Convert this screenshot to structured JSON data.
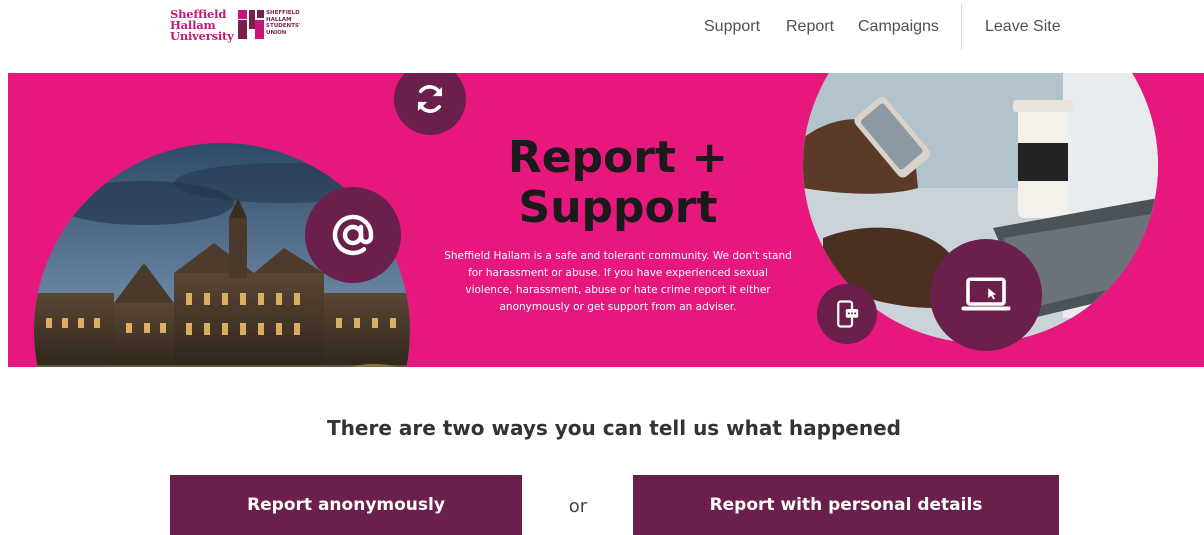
{
  "header": {
    "logo_university_lines": [
      "Sheffield",
      "Hallam",
      "University"
    ],
    "logo_union_lines": [
      "SHEFFIELD",
      "HALLAM",
      "STUDENTS'",
      "UNION"
    ],
    "nav": [
      {
        "label": "Support"
      },
      {
        "label": "Report"
      },
      {
        "label": "Campaigns"
      }
    ],
    "leave_site": "Leave Site"
  },
  "hero": {
    "title_line1": "Report +",
    "title_line2": "Support",
    "description": "Sheffield Hallam is a safe and tolerant community. We don't stand for harassment or abuse. If you have experienced sexual violence, harassment, abuse or hate crime report it either anonymously or get support from an adviser.",
    "icons": [
      "refresh-icon",
      "at-sign-icon",
      "phone-chat-icon",
      "laptop-icon"
    ],
    "colors": {
      "background": "#e6187e",
      "icon_circle": "#6b1f4b"
    }
  },
  "main": {
    "tagline": "There are two ways you can tell us what happened",
    "report_anonymous_label": "Report anonymously",
    "or_label": "or",
    "report_personal_label": "Report with personal details",
    "button_color": "#6b1f4b"
  }
}
